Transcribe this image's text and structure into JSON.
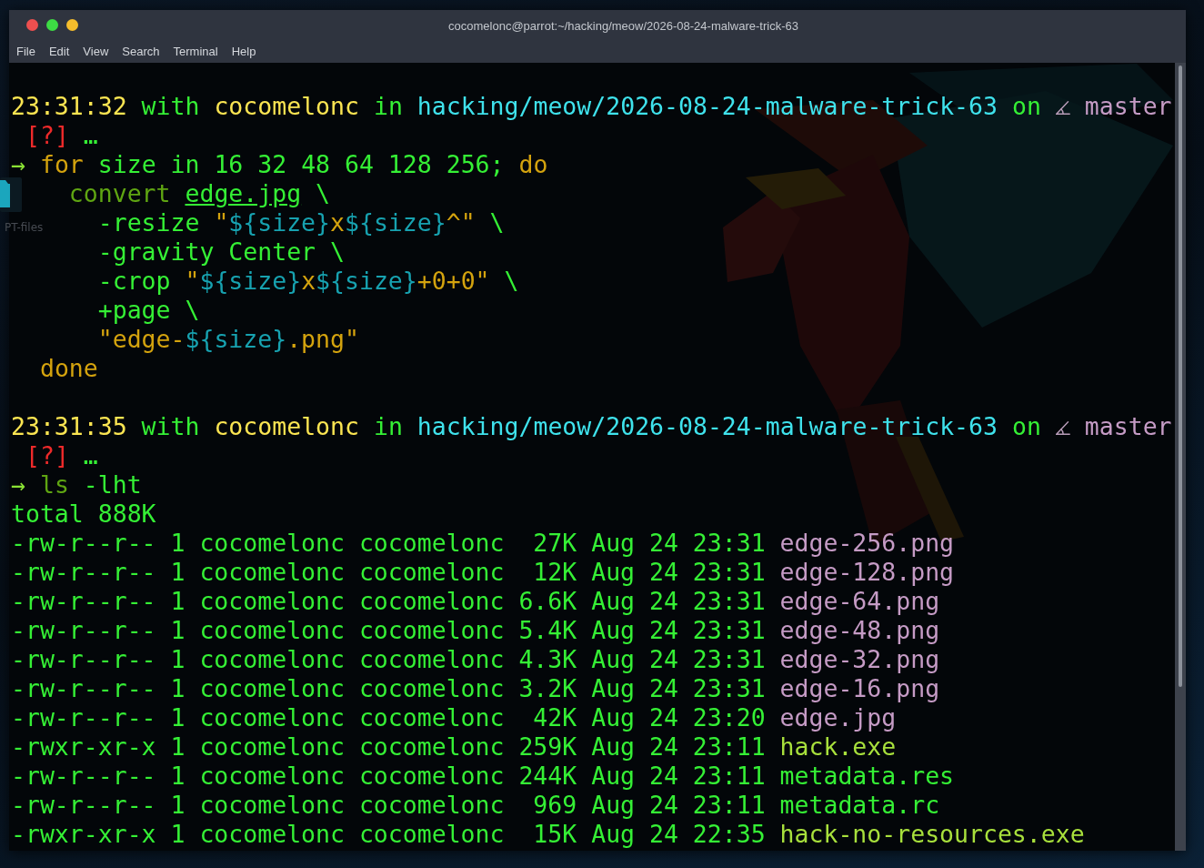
{
  "window": {
    "title": "cocomelonc@parrot:~/hacking/meow/2026-08-24-malware-trick-63",
    "buttons": [
      {
        "kind": "close"
      },
      {
        "kind": "maximize"
      },
      {
        "kind": "minimize"
      }
    ]
  },
  "menu": [
    "File",
    "Edit",
    "View",
    "Search",
    "Terminal",
    "Help"
  ],
  "desktop": {
    "icon_label": "PT-files"
  },
  "terminal": {
    "sessions": [
      {
        "prompt": {
          "time": "23:31:32",
          "with": "with",
          "user": "cocomelonc",
          "in": "in",
          "path": "hacking/meow/2026-08-24-malware-trick-63",
          "on": "on",
          "branch": "master"
        },
        "status": {
          "flag": "[?]",
          "more": "…"
        },
        "arrow": "→",
        "command": [
          [
            {
              "text": "for",
              "kind": "keyword"
            },
            {
              "text": " size in 16 32 48 64 128 256; ",
              "kind": "arg"
            },
            {
              "text": "do",
              "kind": "keyword"
            }
          ],
          [
            {
              "text": "    convert ",
              "kind": "program"
            },
            {
              "text": "edge.jpg",
              "kind": "file"
            },
            {
              "text": " \\",
              "kind": "arg"
            }
          ],
          [
            {
              "text": "      -resize ",
              "kind": "arg"
            },
            {
              "text": "\"",
              "kind": "string"
            },
            {
              "text": "${size}",
              "kind": "var"
            },
            {
              "text": "x",
              "kind": "string"
            },
            {
              "text": "${size}",
              "kind": "var"
            },
            {
              "text": "^\"",
              "kind": "string"
            },
            {
              "text": " \\",
              "kind": "arg"
            }
          ],
          [
            {
              "text": "      -gravity Center \\",
              "kind": "arg"
            }
          ],
          [
            {
              "text": "      -crop ",
              "kind": "arg"
            },
            {
              "text": "\"",
              "kind": "string"
            },
            {
              "text": "${size}",
              "kind": "var"
            },
            {
              "text": "x",
              "kind": "string"
            },
            {
              "text": "${size}",
              "kind": "var"
            },
            {
              "text": "+0+0\"",
              "kind": "string"
            },
            {
              "text": " \\",
              "kind": "arg"
            }
          ],
          [
            {
              "text": "      +page \\",
              "kind": "arg"
            }
          ],
          [
            {
              "text": "      \"edge-",
              "kind": "string"
            },
            {
              "text": "${size}",
              "kind": "var"
            },
            {
              "text": ".png\"",
              "kind": "string"
            }
          ],
          [
            {
              "text": "  done",
              "kind": "keyword"
            }
          ]
        ]
      },
      {
        "prompt": {
          "time": "23:31:35",
          "with": "with",
          "user": "cocomelonc",
          "in": "in",
          "path": "hacking/meow/2026-08-24-malware-trick-63",
          "on": "on",
          "branch": "master"
        },
        "status": {
          "flag": "[?]",
          "more": "…"
        },
        "arrow": "→",
        "command": [
          [
            {
              "text": "ls",
              "kind": "program"
            },
            {
              "text": " -lht",
              "kind": "arg"
            }
          ]
        ],
        "output": {
          "total": "total 888K",
          "entries": [
            {
              "mode": "-rw-r--r--",
              "links": "1",
              "owner": "cocomelonc",
              "group": "cocomelonc",
              "size": "27K",
              "month": "Aug",
              "day": "24",
              "time": "23:31",
              "name": "edge-256.png",
              "kind": "image"
            },
            {
              "mode": "-rw-r--r--",
              "links": "1",
              "owner": "cocomelonc",
              "group": "cocomelonc",
              "size": "12K",
              "month": "Aug",
              "day": "24",
              "time": "23:31",
              "name": "edge-128.png",
              "kind": "image"
            },
            {
              "mode": "-rw-r--r--",
              "links": "1",
              "owner": "cocomelonc",
              "group": "cocomelonc",
              "size": "6.6K",
              "month": "Aug",
              "day": "24",
              "time": "23:31",
              "name": "edge-64.png",
              "kind": "image"
            },
            {
              "mode": "-rw-r--r--",
              "links": "1",
              "owner": "cocomelonc",
              "group": "cocomelonc",
              "size": "5.4K",
              "month": "Aug",
              "day": "24",
              "time": "23:31",
              "name": "edge-48.png",
              "kind": "image"
            },
            {
              "mode": "-rw-r--r--",
              "links": "1",
              "owner": "cocomelonc",
              "group": "cocomelonc",
              "size": "4.3K",
              "month": "Aug",
              "day": "24",
              "time": "23:31",
              "name": "edge-32.png",
              "kind": "image"
            },
            {
              "mode": "-rw-r--r--",
              "links": "1",
              "owner": "cocomelonc",
              "group": "cocomelonc",
              "size": "3.2K",
              "month": "Aug",
              "day": "24",
              "time": "23:31",
              "name": "edge-16.png",
              "kind": "image"
            },
            {
              "mode": "-rw-r--r--",
              "links": "1",
              "owner": "cocomelonc",
              "group": "cocomelonc",
              "size": "42K",
              "month": "Aug",
              "day": "24",
              "time": "23:20",
              "name": "edge.jpg",
              "kind": "image"
            },
            {
              "mode": "-rwxr-xr-x",
              "links": "1",
              "owner": "cocomelonc",
              "group": "cocomelonc",
              "size": "259K",
              "month": "Aug",
              "day": "24",
              "time": "23:11",
              "name": "hack.exe",
              "kind": "executable"
            },
            {
              "mode": "-rw-r--r--",
              "links": "1",
              "owner": "cocomelonc",
              "group": "cocomelonc",
              "size": "244K",
              "month": "Aug",
              "day": "24",
              "time": "23:11",
              "name": "metadata.res",
              "kind": "file"
            },
            {
              "mode": "-rw-r--r--",
              "links": "1",
              "owner": "cocomelonc",
              "group": "cocomelonc",
              "size": "969",
              "month": "Aug",
              "day": "24",
              "time": "23:11",
              "name": "metadata.rc",
              "kind": "file"
            },
            {
              "mode": "-rwxr-xr-x",
              "links": "1",
              "owner": "cocomelonc",
              "group": "cocomelonc",
              "size": "15K",
              "month": "Aug",
              "day": "24",
              "time": "22:35",
              "name": "hack-no-resources.exe",
              "kind": "executable"
            }
          ]
        }
      }
    ]
  }
}
